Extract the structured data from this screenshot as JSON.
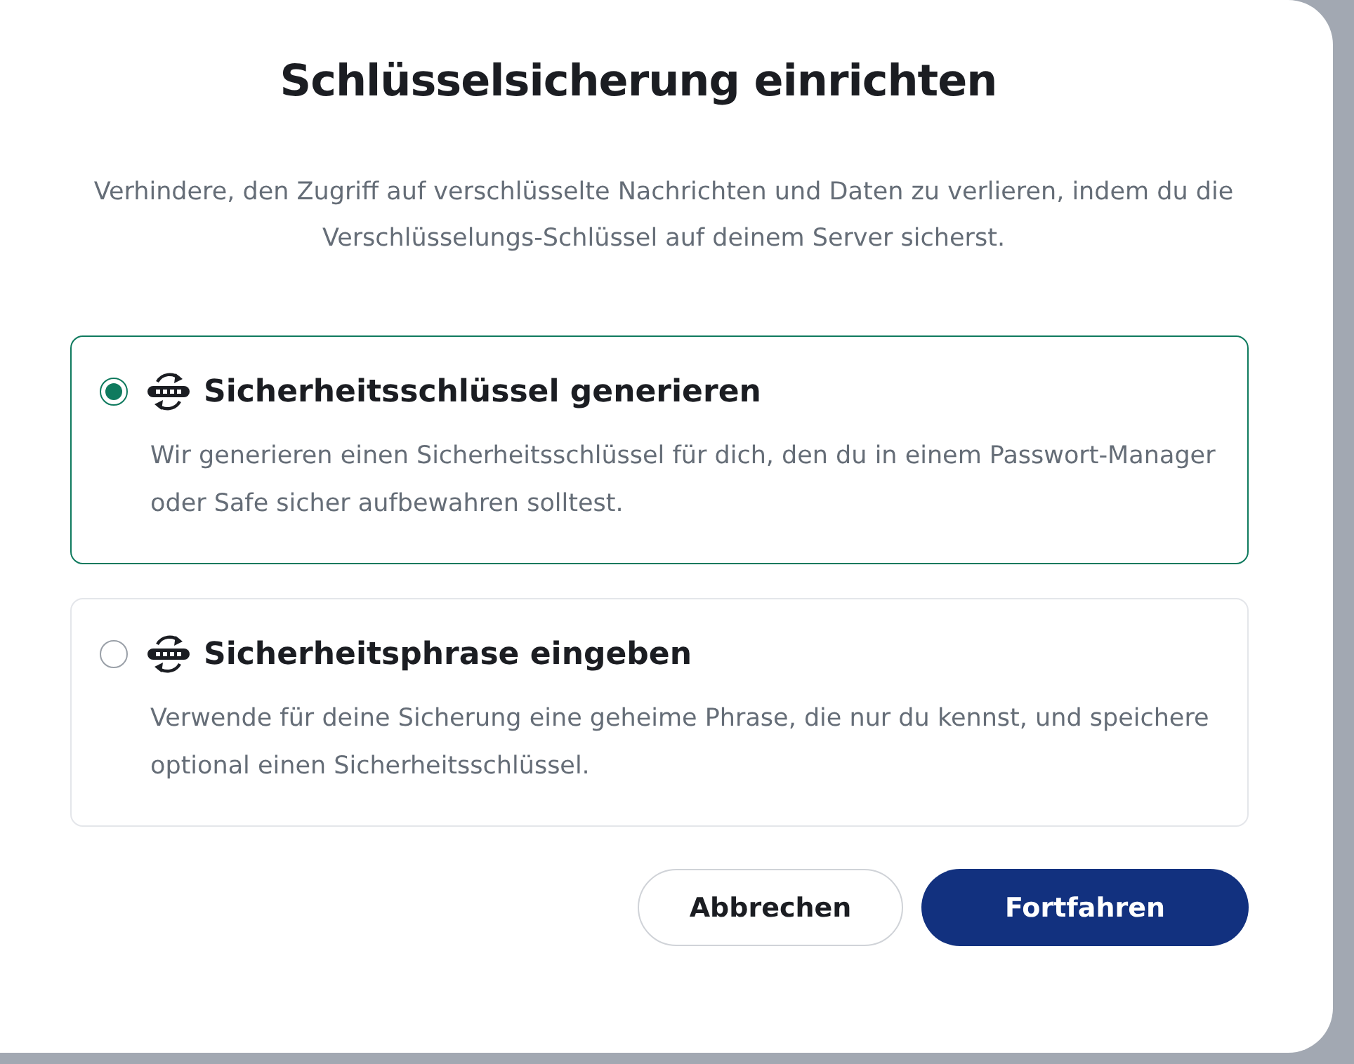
{
  "dialog": {
    "title": "Schlüsselsicherung einrichten",
    "description": "Verhindere, den Zugriff auf verschlüsselte Nachrichten und Daten zu verlieren, indem du die Verschlüsselungs-Schlüssel auf deinem Server sicherst.",
    "options": [
      {
        "label": "Sicherheitsschlüssel generieren",
        "description": "Wir generieren einen Sicherheitsschlüssel für dich, den du in einem Passwort-Manager oder Safe sicher aufbewahren solltest.",
        "selected": true
      },
      {
        "label": "Sicherheitsphrase eingeben",
        "description": "Verwende für deine Sicherung eine geheime Phrase, die nur du kennst, und speichere optional einen Sicherheitsschlüssel.",
        "selected": false
      }
    ],
    "buttons": [
      {
        "label": "Abbrechen",
        "kind": "secondary"
      },
      {
        "label": "Fortfahren",
        "kind": "primary"
      }
    ]
  }
}
